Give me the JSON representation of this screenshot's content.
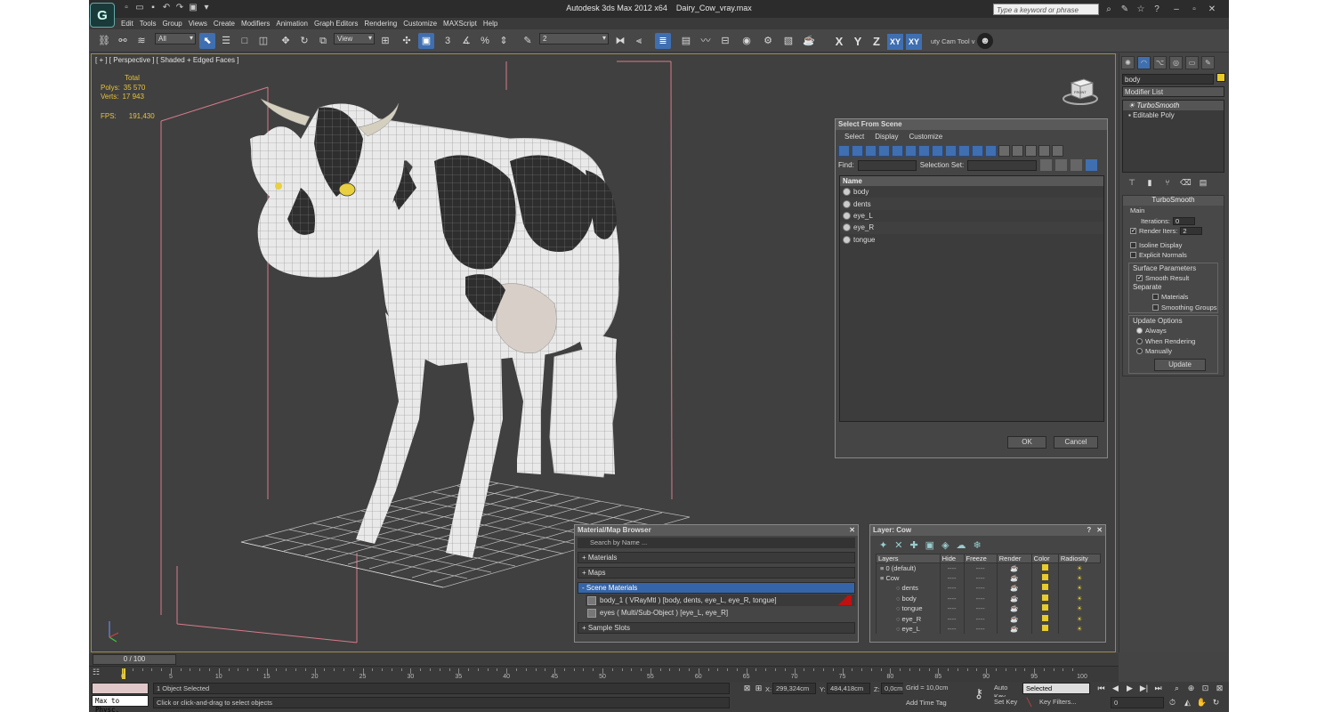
{
  "window": {
    "app_title": "Autodesk 3ds Max  2012 x64",
    "file_name": "Dairy_Cow_vray.max",
    "search_placeholder": "Type a keyword or phrase"
  },
  "menu": [
    "Edit",
    "Tools",
    "Group",
    "Views",
    "Create",
    "Modifiers",
    "Animation",
    "Graph Editors",
    "Rendering",
    "Customize",
    "MAXScript",
    "Help"
  ],
  "toolbar": {
    "selection_filter": "All",
    "ref_coord": "View",
    "named_sel": "2",
    "cam_tool": "uty Cam Tool v"
  },
  "viewport": {
    "label": "[ + ] [ Perspective ] [ Shaded + Edged Faces ]",
    "stats_total": "Total",
    "polys_label": "Polys:",
    "polys": "35 570",
    "verts_label": "Verts:",
    "verts": "17 943",
    "fps_label": "FPS:",
    "fps": "191,430",
    "viewcube_label": "FRONT"
  },
  "select_from_scene": {
    "title": "Select From Scene",
    "menu": [
      "Select",
      "Display",
      "Customize"
    ],
    "find_label": "Find:",
    "selection_set_label": "Selection Set:",
    "column_name": "Name",
    "objects": [
      "body",
      "dents",
      "eye_L",
      "eye_R",
      "tongue"
    ],
    "ok": "OK",
    "cancel": "Cancel"
  },
  "material_browser": {
    "title": "Material/Map Browser",
    "search_placeholder": "Search by Name ...",
    "sections": [
      "+ Materials",
      "+ Maps",
      "- Scene Materials",
      "+ Sample Slots"
    ],
    "materials": [
      "body_1  ( VRayMtl ) [body, dents, eye_L, eye_R, tongue]",
      "eyes  ( Multi/Sub-Object ) [eye_L, eye_R]"
    ]
  },
  "layer_dialog": {
    "title": "Layer: Cow",
    "columns": [
      "Layers",
      "Hide",
      "Freeze",
      "Render",
      "Color",
      "Radiosity"
    ],
    "rows": [
      {
        "name": "0 (default)",
        "indent": false
      },
      {
        "name": "Cow",
        "indent": false
      },
      {
        "name": "dents",
        "indent": true
      },
      {
        "name": "body",
        "indent": true
      },
      {
        "name": "tongue",
        "indent": true
      },
      {
        "name": "eye_R",
        "indent": true
      },
      {
        "name": "eye_L",
        "indent": true
      }
    ],
    "dash": "----"
  },
  "command_panel": {
    "object_name": "body",
    "modifier_list": "Modifier List",
    "stack": [
      "TurboSmooth",
      "Editable Poly"
    ],
    "turbosmooth": {
      "title": "TurboSmooth",
      "main": "Main",
      "iterations_label": "Iterations:",
      "iterations": "0",
      "render_iters_label": "Render Iters:",
      "render_iters": "2",
      "isoline": "Isoline Display",
      "explicit": "Explicit Normals",
      "surface_params": "Surface Parameters",
      "smooth_result": "Smooth Result",
      "separate": "Separate",
      "materials": "Materials",
      "smoothing_groups": "Smoothing Groups",
      "update_options": "Update Options",
      "always": "Always",
      "when_rendering": "When Rendering",
      "manually": "Manually",
      "update": "Update"
    }
  },
  "timeline": {
    "frame_display": "0 / 100",
    "ticks": [
      "0",
      "5",
      "10",
      "15",
      "20",
      "25",
      "30",
      "35",
      "40",
      "45",
      "50",
      "55",
      "60",
      "65",
      "70",
      "75",
      "80",
      "85",
      "90",
      "95",
      "100"
    ]
  },
  "status": {
    "maxscript": "Max to Physc.",
    "selected": "1 Object Selected",
    "prompt": "Click or click-and-drag to select objects",
    "x_label": "X:",
    "x": "299,324cm",
    "y_label": "Y:",
    "y": "484,418cm",
    "z_label": "Z:",
    "z": "0,0cm",
    "grid": "Grid = 10,0cm",
    "add_time_tag": "Add Time Tag",
    "auto_key": "Auto Key",
    "set_key": "Set Key",
    "key_mode": "Selected",
    "key_filters": "Key Filters...",
    "frame": "0"
  }
}
